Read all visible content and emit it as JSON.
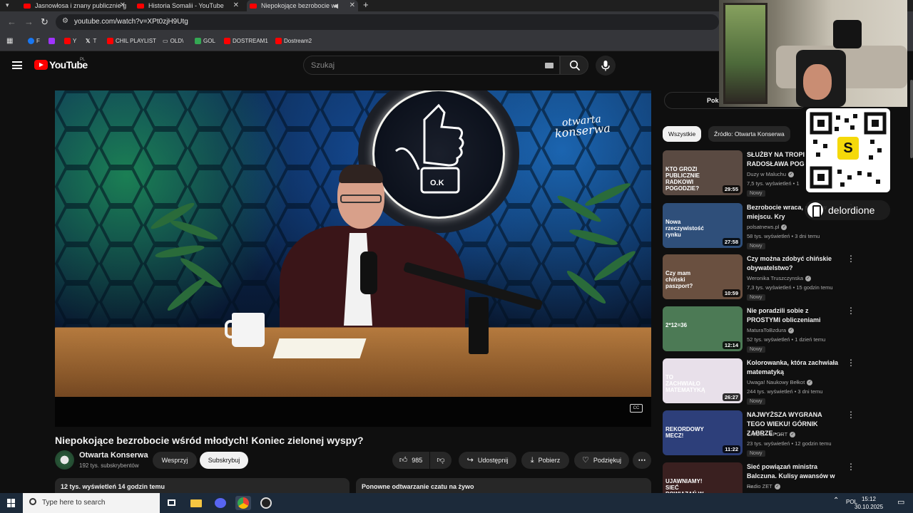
{
  "browser": {
    "tabs": [
      {
        "label": "Jasnowłosa i znany publicznie g"
      },
      {
        "label": "Historia Somalii - YouTube"
      },
      {
        "label": "Niepokojące bezrobocie w"
      }
    ],
    "url": "youtube.com/watch?v=XPt0zjH9Utg",
    "bookmarks": [
      {
        "label": "F",
        "color": "#1877f2"
      },
      {
        "label": "Y",
        "color": "#ff0000"
      },
      {
        "label": "T",
        "color": "#ffffff"
      },
      {
        "label": "CHIL PLAYLIST",
        "color": "#ff0000"
      },
      {
        "label": "OLD\\",
        "color": "#dddddd"
      },
      {
        "label": "GOL",
        "color": "#34a853"
      },
      {
        "label": "DOSTREAM1",
        "color": "#ff0000"
      },
      {
        "label": "Dostream2",
        "color": "#ff0000"
      }
    ]
  },
  "youtube": {
    "logo_text": "YouTube",
    "country_code": "PL",
    "search_placeholder": "Szukaj"
  },
  "player": {
    "watermark_line1": "otwarta",
    "watermark_line2": "konserwa",
    "sign_text": "O.K"
  },
  "video": {
    "title": "Niepokojące bezrobocie wśród młodych! Koniec zielonej wyspy?",
    "channel": "Otwarta Konserwa",
    "subscribers": "192 tys. subskrybentów",
    "support_label": "Wesprzyj",
    "subscribe_label": "Subskrybuj",
    "likes": "985",
    "share_label": "Udostępnij",
    "download_label": "Pobierz",
    "thanks_label": "Podziękuj",
    "views_time": "12 tys. wyświetleń  14 godzin temu",
    "chat_replay": "Ponowne odtwarzanie czatu na żywo"
  },
  "sidebar": {
    "show_chat_label": "Pok",
    "chips": [
      {
        "label": "Wszystkie",
        "active": true
      },
      {
        "label": "Źródło: Otwarta Konserwa",
        "active": false
      }
    ],
    "recommendations": [
      {
        "title": "SŁUŻBY NA TROPI RADOSŁAWA POG",
        "channel": "Duzy w Maluchu",
        "meta": "7,5 tys. wyświetleń • 1",
        "badge": "Nowy",
        "duration": "29:55",
        "thumb_text": "KTO GROZI PUBLICZNIE RADKOWI POGODZIE?",
        "thumb_color": "#5a4a42"
      },
      {
        "title": "Bezrobocie wraca, stoją w miejscu. Kry",
        "channel": "polsatnews.pl",
        "meta": "58 tys. wyświetleń • 3 dni temu",
        "badge": "Nowy",
        "duration": "27:58",
        "thumb_text": "Nowa rzeczywistość rynku",
        "thumb_color": "#2f4f7a"
      },
      {
        "title": "Czy można zdobyć chińskie obywatelstwo?",
        "channel": "Weronika Truszczynska",
        "meta": "7,3 tys. wyświetleń • 15 godzin temu",
        "badge": "Nowy",
        "duration": "10:59",
        "thumb_text": "Czy mam chiński paszport?",
        "thumb_color": "#6a5040"
      },
      {
        "title": "Nie poradzili sobie z PROSTYMI obliczeniami",
        "channel": "MaturaToBzdura",
        "meta": "52 tys. wyświetleń • 1 dzień temu",
        "badge": "Nowy",
        "duration": "12:14",
        "thumb_text": "2*12=36",
        "thumb_color": "#4c7a55"
      },
      {
        "title": "Kolorowanka, która zachwiała matematyką",
        "channel": "Uwaga! Naukowy Bełkot",
        "meta": "244 tys. wyświetleń • 3 dni temu",
        "badge": "Nowy",
        "duration": "26:27",
        "thumb_text": "TO ZACHWIAŁO MATEMATYKĄ",
        "thumb_color": "#e8e0ea"
      },
      {
        "title": "NAJWYŻSZA WYGRANA TEGO WIEKU! GÓRNIK ZABRZE - ...",
        "channel": "CANAL+ SPORT",
        "meta": "23 tys. wyświetleń • 12 godzin temu",
        "badge": "Nowy",
        "duration": "11:22",
        "thumb_text": "REKORDOWY MECZ!",
        "thumb_color": "#2d3f7a"
      },
      {
        "title": "Sieć powiązań ministra Balczuna. Kulisy awansów w ...",
        "channel": "Radio ZET",
        "meta": "",
        "badge": "",
        "duration": "",
        "thumb_text": "UJAWNIAMY! SIEĆ POWIĄZAŃ W SPÓŁKACH PAŃSTWA",
        "thumb_color": "#3a2020"
      }
    ]
  },
  "overlay": {
    "qr_letter": "S",
    "handle": "delordione"
  },
  "taskbar": {
    "search_placeholder": "Type here to search",
    "language": "POL",
    "time": "15:12",
    "date": "30.10.2025"
  }
}
